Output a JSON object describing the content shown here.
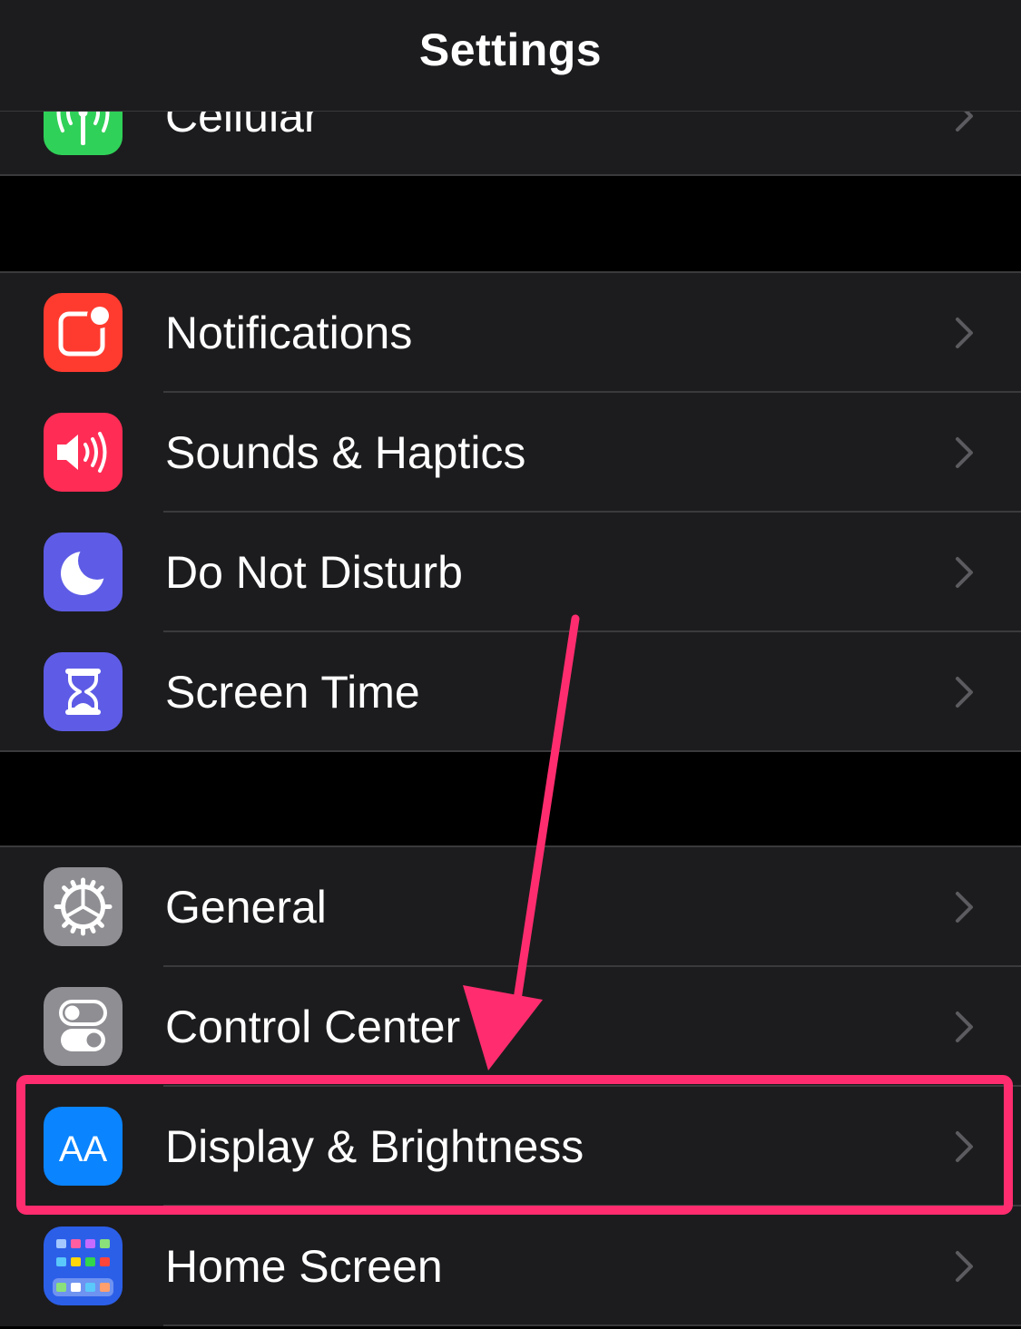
{
  "header": {
    "title": "Settings"
  },
  "rows": {
    "cellular": {
      "label": "Cellular",
      "icon": "cellular-antenna-icon",
      "color": "#30d158"
    },
    "notifications": {
      "label": "Notifications",
      "icon": "notifications-icon",
      "color": "#ff3b30"
    },
    "sounds": {
      "label": "Sounds & Haptics",
      "icon": "speaker-icon",
      "color": "#ff2d55"
    },
    "do_not_disturb": {
      "label": "Do Not Disturb",
      "icon": "moon-icon",
      "color": "#5e5ce6"
    },
    "screen_time": {
      "label": "Screen Time",
      "icon": "hourglass-icon",
      "color": "#5e5ce6"
    },
    "general": {
      "label": "General",
      "icon": "gear-icon",
      "color": "#8e8e93"
    },
    "control_center": {
      "label": "Control Center",
      "icon": "toggles-icon",
      "color": "#8e8e93"
    },
    "display": {
      "label": "Display & Brightness",
      "icon": "text-size-icon",
      "icon_text": "AA",
      "color": "#0a84ff"
    },
    "home_screen": {
      "label": "Home Screen",
      "icon": "app-grid-icon",
      "color": "#2c5fe8"
    }
  },
  "annotation": {
    "color": "#ff2d6f",
    "highlighted_row": "Display & Brightness"
  }
}
